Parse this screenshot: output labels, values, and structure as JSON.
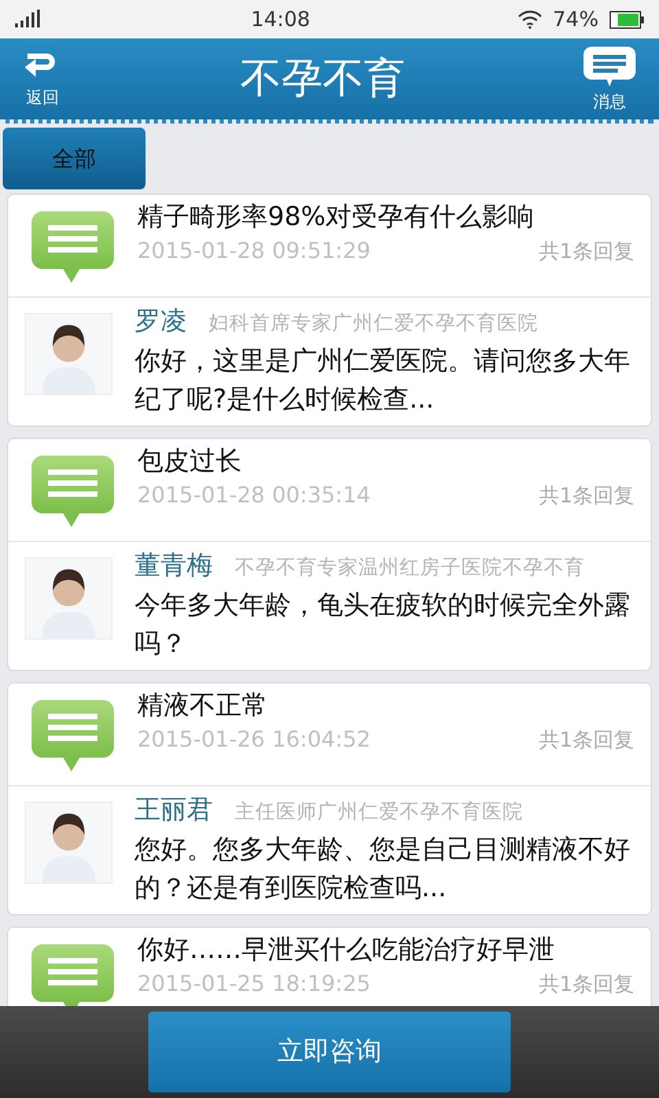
{
  "status_bar": {
    "time": "14:08",
    "battery": "74%"
  },
  "header": {
    "back_label": "返回",
    "title": "不孕不育",
    "messages_label": "消息"
  },
  "tabs": [
    {
      "label": "全部",
      "selected": true
    }
  ],
  "questions": [
    {
      "title": "精子畸形率98%对受孕有什么影响",
      "date": "2015-01-28 09:51:29",
      "replies": "共1条回复",
      "doctor": {
        "name": "罗凌",
        "title": "妇科首席专家广州仁爱不孕不育医院",
        "reply": "你好，这里是广州仁爱医院。请问您多大年纪了呢?是什么时候检查..."
      }
    },
    {
      "title": "包皮过长",
      "date": "2015-01-28 00:35:14",
      "replies": "共1条回复",
      "doctor": {
        "name": "董青梅",
        "title": "不孕不育专家温州红房子医院不孕不育",
        "reply": "今年多大年龄，龟头在疲软的时候完全外露吗？"
      }
    },
    {
      "title": "精液不正常",
      "date": "2015-01-26 16:04:52",
      "replies": "共1条回复",
      "doctor": {
        "name": "王丽君",
        "title": "主任医师广州仁爱不孕不育医院",
        "reply": "您好。您多大年龄、您是自己目测精液不好的？还是有到医院检查吗..."
      }
    },
    {
      "title": "你好……早泄买什么吃能治疗好早泄",
      "date": "2015-01-25 18:19:25",
      "replies": "共1条回复"
    }
  ],
  "consult_button": "立即咨询"
}
